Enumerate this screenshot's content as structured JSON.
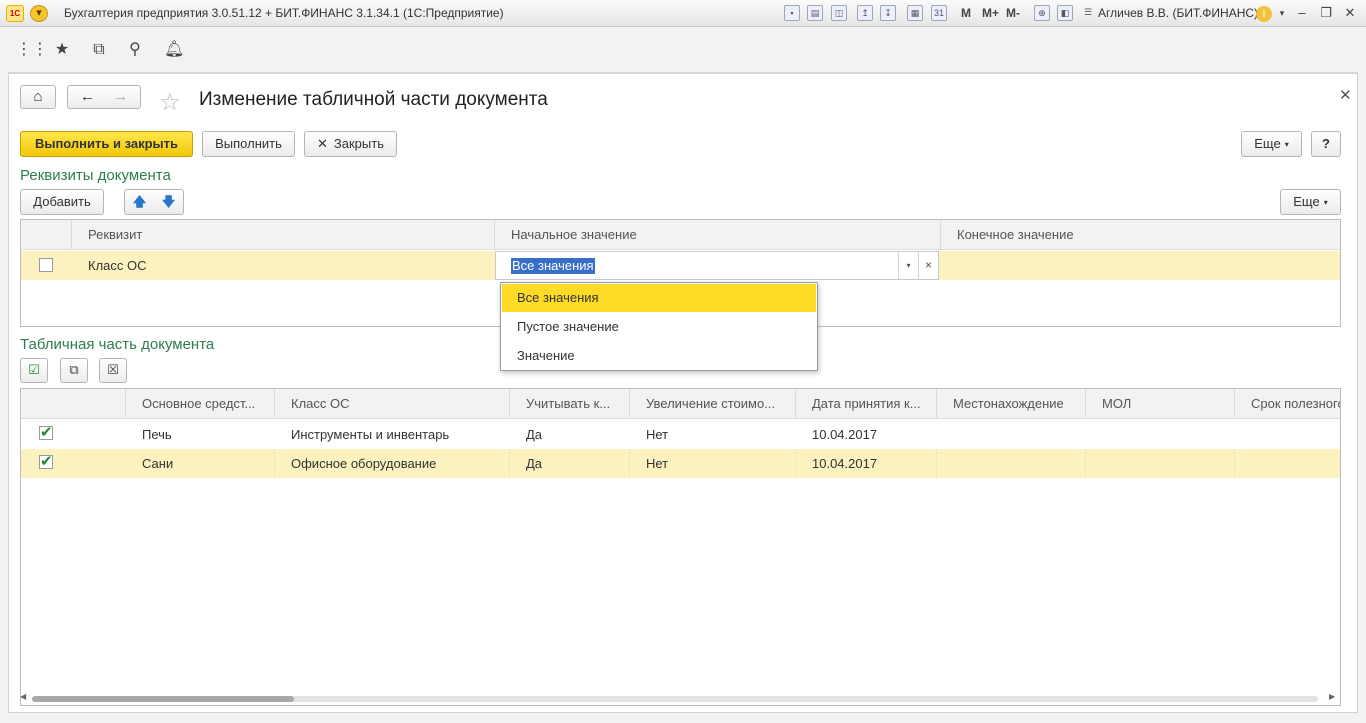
{
  "app": {
    "title": "Бухгалтерия предприятия 3.0.51.12 + БИТ.ФИНАНС 3.1.34.1  (1С:Предприятие)",
    "logo_text": "1С",
    "toolbar_m": "M",
    "toolbar_mplus": "M+",
    "toolbar_mminus": "M-",
    "user": "Агличев В.В. (БИТ.ФИНАНС)"
  },
  "form": {
    "title": "Изменение табличной части документа",
    "buttons": {
      "run_close": "Выполнить и закрыть",
      "run": "Выполнить",
      "close": "Закрыть",
      "more": "Еще",
      "help": "?"
    }
  },
  "requisites": {
    "section_title": "Реквизиты документа",
    "add_button": "Добавить",
    "more_button": "Еще",
    "columns": [
      "Реквизит",
      "Начальное значение",
      "Конечное значение"
    ],
    "rows": [
      {
        "checked": false,
        "name": "Класс ОС",
        "start_value": "Все значения",
        "end_value": ""
      }
    ],
    "dropdown_options": [
      "Все значения",
      "Пустое значение",
      "Значение"
    ],
    "dropdown_selected": "Все значения"
  },
  "tablepart": {
    "section_title": "Табличная часть документа",
    "columns": [
      "Основное средст...",
      "Класс ОС",
      "Учитывать к...",
      "Увеличение стоимо...",
      "Дата принятия к...",
      "Местонахождение",
      "МОЛ",
      "Срок полезного"
    ],
    "rows": [
      {
        "checked": true,
        "cells": [
          "Печь",
          "Инструменты и инвентарь",
          "Да",
          "Нет",
          "10.04.2017",
          "",
          "",
          ""
        ]
      },
      {
        "checked": true,
        "cells": [
          "Сани",
          "Офисное оборудование",
          "Да",
          "Нет",
          "10.04.2017",
          "",
          "",
          ""
        ]
      }
    ],
    "selected_row": 1
  },
  "colors": {
    "accent_yellow": "#fddb27",
    "section_green": "#2e7d4f",
    "selected_row": "#fbf2c0"
  }
}
